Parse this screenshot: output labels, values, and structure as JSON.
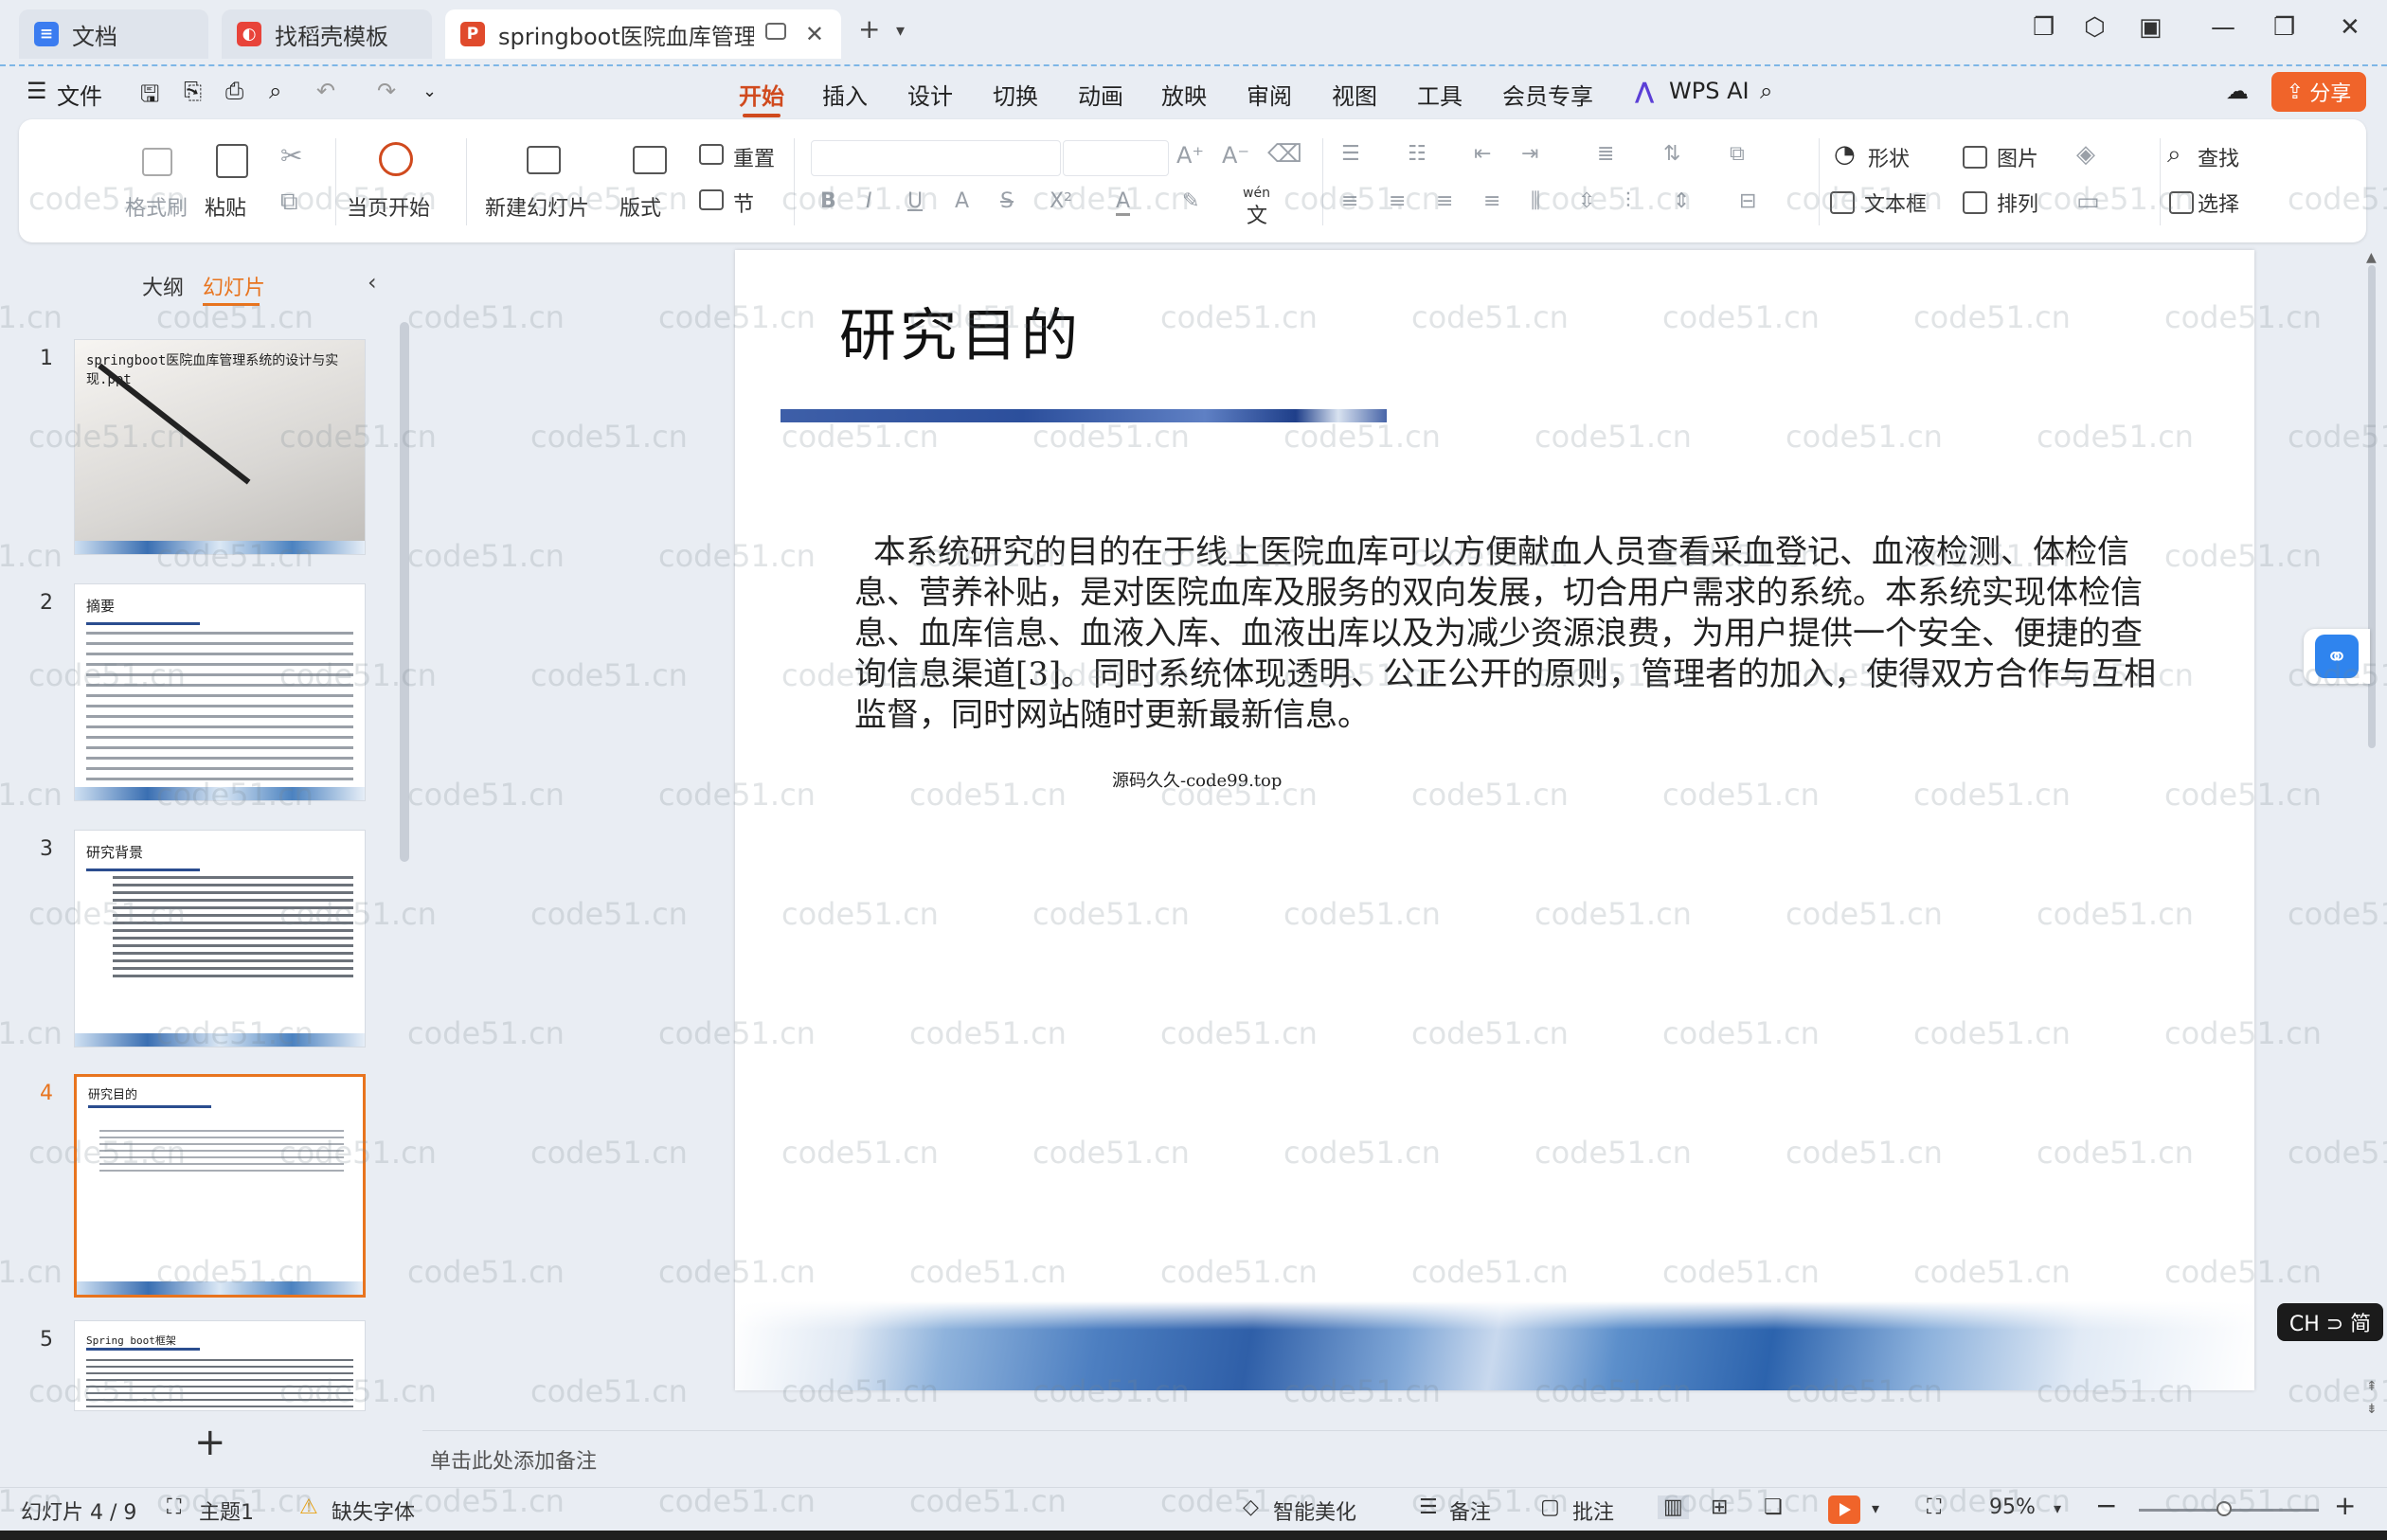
{
  "tabs": [
    {
      "label": "文档",
      "icon": "docs-icon"
    },
    {
      "label": "找稻壳模板",
      "icon": "docer-icon"
    },
    {
      "label": "springboot医院血库管理系统",
      "icon": "ppt-icon"
    }
  ],
  "menu": {
    "file": "文件",
    "items": [
      "开始",
      "插入",
      "设计",
      "切换",
      "动画",
      "放映",
      "审阅",
      "视图",
      "工具",
      "会员专享"
    ],
    "active": "开始",
    "ai": "WPS AI",
    "share": "分享"
  },
  "ribbon": {
    "format_painter": "格式刷",
    "paste": "粘贴",
    "play_from_current": "当页开始",
    "new_slide": "新建幻灯片",
    "layout": "版式",
    "reset": "重置",
    "section": "节",
    "phonetic": "wén",
    "shape": "形状",
    "picture": "图片",
    "find": "查找",
    "textbox": "文本框",
    "arrange": "排列",
    "select": "选择"
  },
  "left_panel": {
    "tab_outline": "大纲",
    "tab_slides": "幻灯片",
    "slides": [
      {
        "num": "1",
        "title": "springboot医院血库管理系统的设计与实现.ppt"
      },
      {
        "num": "2",
        "title": "摘要"
      },
      {
        "num": "3",
        "title": "研究背景"
      },
      {
        "num": "4",
        "title": "研究目的"
      },
      {
        "num": "5",
        "title": "Spring boot框架"
      }
    ],
    "selected": 4
  },
  "slide": {
    "title": "研究目的",
    "body": "本系统研究的目的在于线上医院血库可以方便献血人员查看采血登记、血液检测、体检信息、营养补贴，是对医院血库及服务的双向发展，切合用户需求的系统。本系统实现体检信息、血库信息、血液入库、血液出库以及为减少资源浪费，为用户提供一个安全、便捷的查询信息渠道[3]。同时系统体现透明、公正公开的原则，管理者的加入，使得双方合作与互相监督，同时网站随时更新最新信息。",
    "footnote": "源码久久-code99.top"
  },
  "notes": {
    "placeholder": "单击此处添加备注"
  },
  "status": {
    "slide_counter": "幻灯片 4 / 9",
    "theme": "主题1",
    "missing_font": "缺失字体",
    "beautify": "智能美化",
    "notes_btn": "备注",
    "comment_btn": "批注",
    "zoom": "95%"
  },
  "ime": "CH ⊃ 简",
  "watermark": "code51.cn",
  "colors": {
    "accent": "#d04a1e",
    "selection": "#e8741e",
    "share": "#f0642a"
  }
}
